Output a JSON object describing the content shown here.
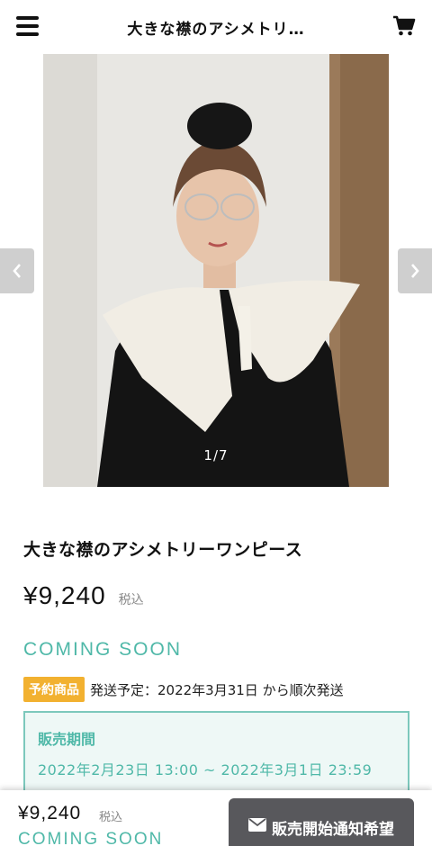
{
  "header": {
    "title": "大きな襟のアシメトリ…",
    "menu_icon": "hamburger-menu-icon",
    "cart_icon": "cart-icon"
  },
  "carousel": {
    "counter": "1/7",
    "prev_icon": "chevron-left-icon",
    "next_icon": "chevron-right-icon"
  },
  "product": {
    "name": "大きな襟のアシメトリーワンピース",
    "price": "¥9,240",
    "tax_label": "税込",
    "status": "COMING SOON",
    "preorder_badge": "予約商品",
    "shipping_text": "発送予定：2022年3月31日 から順次発送",
    "sale_period_title": "販売期間",
    "sale_period": "2022年2月23日 13:00 ~ 2022年3月1日 23:59"
  },
  "bottom_bar": {
    "price": "¥9,240",
    "tax_label": "税込",
    "status": "COMING SOON",
    "notify_button": "販売開始通知希望",
    "notify_icon": "envelope-icon"
  },
  "colors": {
    "accent_teal": "#4fb8a8",
    "badge_orange": "#f2b130",
    "button_gray": "#58585c"
  }
}
